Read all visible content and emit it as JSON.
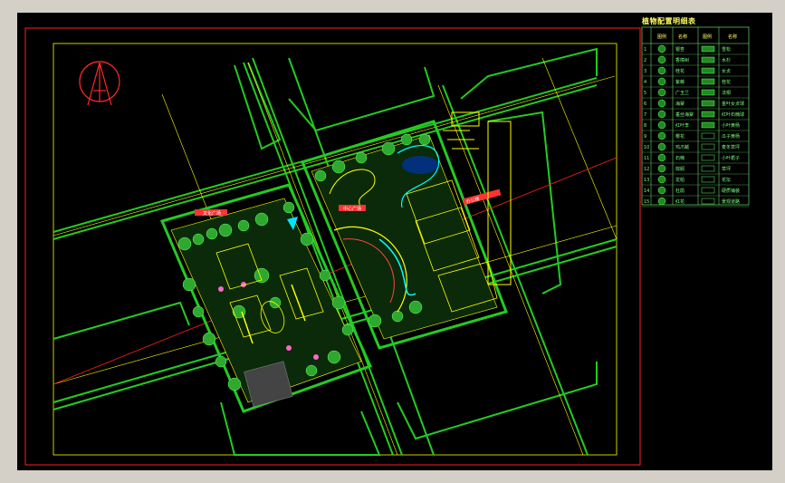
{
  "legend": {
    "title": "植物配置明细表",
    "headers": [
      "图例",
      "名称",
      "图例",
      "名称"
    ],
    "left_rows": [
      {
        "no": "1",
        "name": "银杏"
      },
      {
        "no": "2",
        "name": "香樟树"
      },
      {
        "no": "3",
        "name": "桂花"
      },
      {
        "no": "4",
        "name": "紫薇"
      },
      {
        "no": "5",
        "name": "广玉兰"
      },
      {
        "no": "6",
        "name": "海棠"
      },
      {
        "no": "7",
        "name": "垂丝海棠"
      },
      {
        "no": "8",
        "name": "红叶李"
      },
      {
        "no": "9",
        "name": "樱花"
      },
      {
        "no": "10",
        "name": "鸡爪槭"
      },
      {
        "no": "11",
        "name": "石楠"
      },
      {
        "no": "12",
        "name": "棕榈"
      },
      {
        "no": "13",
        "name": "龙柏"
      },
      {
        "no": "14",
        "name": "杜鹃"
      },
      {
        "no": "15",
        "name": "红花"
      }
    ],
    "right_rows": [
      {
        "name": "雪松"
      },
      {
        "name": "水杉"
      },
      {
        "name": "女贞"
      },
      {
        "name": "桂花"
      },
      {
        "name": "法桐"
      },
      {
        "name": "金叶女贞球"
      },
      {
        "name": "红叶石楠球"
      },
      {
        "name": "小叶黄杨"
      },
      {
        "name": "瓜子黄杨"
      },
      {
        "name": "麦冬草坪"
      },
      {
        "name": "小叶栀子"
      },
      {
        "name": "草坪"
      },
      {
        "name": "花坛"
      },
      {
        "name": "硬质铺装"
      },
      {
        "name": "景观道路"
      }
    ]
  },
  "plan_labels": {
    "west_plaza": "文化广场",
    "central_plaza": "中心广场",
    "east_building": "办公楼"
  },
  "colors": {
    "background": "#000000",
    "border": "#ff2020",
    "frame_line": "#ffff00",
    "green": "#22cc22",
    "cyan": "#00ffff",
    "magenta": "#ff44ff",
    "red": "#ff3333",
    "window_chrome": "#d4d0c8"
  }
}
